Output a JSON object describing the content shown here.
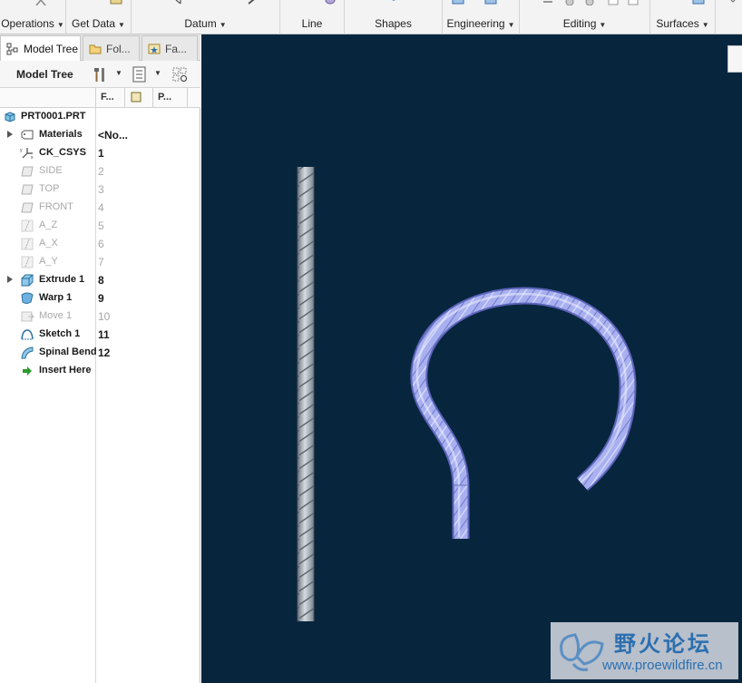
{
  "ribbon": {
    "groups": [
      {
        "label": "Operations",
        "has_menu": true
      },
      {
        "label": "Get Data",
        "has_menu": true
      },
      {
        "label": "Datum",
        "has_menu": true
      },
      {
        "label": "Line",
        "has_menu": false
      },
      {
        "label": "Shapes",
        "has_menu": false
      },
      {
        "label": "Engineering",
        "has_menu": true
      },
      {
        "label": "Editing",
        "has_menu": true
      },
      {
        "label": "Surfaces",
        "has_menu": true
      }
    ]
  },
  "panel": {
    "tabs": [
      {
        "label": "Model Tree",
        "icon": "tree-structure-icon",
        "active": true
      },
      {
        "label": "Fol...",
        "icon": "folder-browser-icon",
        "active": false
      },
      {
        "label": "Fa...",
        "icon": "favorites-icon",
        "active": false
      }
    ],
    "toolbar_title": "Model Tree",
    "columns": [
      "F...",
      "P..."
    ],
    "tree": [
      {
        "label": "PRT0001.PRT",
        "num": "",
        "icon": "part-icon",
        "dim": false,
        "expandable": false
      },
      {
        "label": "Materials",
        "num": "<No...",
        "icon": "materials-icon",
        "dim": false,
        "expandable": true
      },
      {
        "label": "CK_CSYS",
        "num": "1",
        "icon": "coordinate-system-icon",
        "dim": false,
        "expandable": false
      },
      {
        "label": "SIDE",
        "num": "2",
        "icon": "datum-plane-icon",
        "dim": true,
        "expandable": false
      },
      {
        "label": "TOP",
        "num": "3",
        "icon": "datum-plane-icon",
        "dim": true,
        "expandable": false
      },
      {
        "label": "FRONT",
        "num": "4",
        "icon": "datum-plane-icon",
        "dim": true,
        "expandable": false
      },
      {
        "label": "A_Z",
        "num": "5",
        "icon": "datum-axis-icon",
        "dim": true,
        "expandable": false
      },
      {
        "label": "A_X",
        "num": "6",
        "icon": "datum-axis-icon",
        "dim": true,
        "expandable": false
      },
      {
        "label": "A_Y",
        "num": "7",
        "icon": "datum-axis-icon",
        "dim": true,
        "expandable": false
      },
      {
        "label": "Extrude 1",
        "num": "8",
        "icon": "extrude-icon",
        "dim": false,
        "expandable": true
      },
      {
        "label": "Warp 1",
        "num": "9",
        "icon": "warp-icon",
        "dim": false,
        "expandable": false
      },
      {
        "label": "Move 1",
        "num": "10",
        "icon": "move-icon",
        "dim": true,
        "expandable": false
      },
      {
        "label": "Sketch 1",
        "num": "11",
        "icon": "sketch-icon",
        "dim": false,
        "expandable": false
      },
      {
        "label": "Spinal Bend",
        "num": "12",
        "icon": "spinal-bend-icon",
        "dim": false,
        "expandable": false
      },
      {
        "label": "Insert Here",
        "num": "",
        "icon": "insert-here-arrow-icon",
        "dim": false,
        "expandable": false
      }
    ]
  },
  "viewport": {
    "background": "#07263e",
    "rope_color": "#a8b0f0",
    "straight_rope_color": "#b4bcc6"
  },
  "watermark": {
    "name": "野火论坛",
    "url": "www.proewildfire.cn"
  }
}
